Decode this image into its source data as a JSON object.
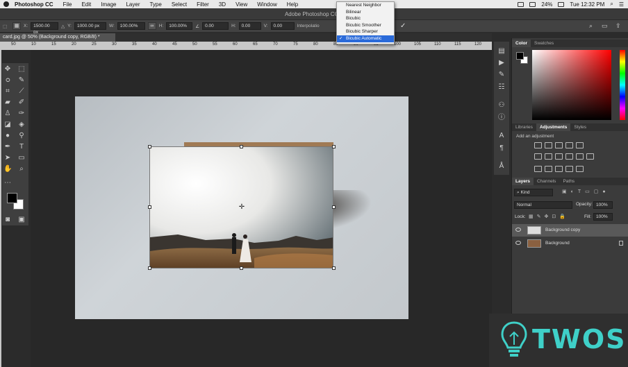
{
  "menubar": {
    "app_name": "Photoshop CC",
    "items": [
      "File",
      "Edit",
      "Image",
      "Layer",
      "Type",
      "Select",
      "Filter",
      "3D",
      "View",
      "Window",
      "Help"
    ],
    "battery": "24%",
    "clock": "Tue 12:32 PM"
  },
  "window": {
    "title": "Adobe Photoshop CC 2"
  },
  "options_bar": {
    "x_label": "X:",
    "x_value": "1500.00 px",
    "y_label": "Y:",
    "y_value": "1000.00 px",
    "w_label": "W:",
    "w_value": "100.00%",
    "h_label": "H:",
    "h_value": "100.00%",
    "angle_value": "0.00",
    "hskew_label": "H:",
    "hskew_value": "0.00",
    "vskew_label": "V:",
    "vskew_value": "0.00",
    "interp_label": "Interpolatio"
  },
  "interpolation_menu": {
    "options": [
      "Nearest Neighbor",
      "Bilinear",
      "Bicubic",
      "Bicubic Smoother",
      "Bicubic Sharper",
      "Bicubic Automatic"
    ],
    "selected": "Bicubic Automatic"
  },
  "document_tab": {
    "label": "card.jpg @ 50% (Background copy, RGB/8) *"
  },
  "ruler_ticks": [
    "50",
    "10",
    "15",
    "20",
    "25",
    "30",
    "35",
    "40",
    "45",
    "50",
    "55",
    "60",
    "65",
    "70",
    "75",
    "80",
    "85",
    "90",
    "95",
    "100",
    "105",
    "110",
    "115",
    "120"
  ],
  "color_panel": {
    "tabs": [
      "Color",
      "Swatches"
    ],
    "active": "Color"
  },
  "adjustments_panel": {
    "tabs": [
      "Libraries",
      "Adjustments",
      "Styles"
    ],
    "active": "Adjustments",
    "heading": "Add an adjustment"
  },
  "layers_panel": {
    "tabs": [
      "Layers",
      "Channels",
      "Paths"
    ],
    "active": "Layers",
    "filter_kind": "Kind",
    "blend_mode": "Normal",
    "opacity_label": "Opacity:",
    "opacity_value": "100%",
    "lock_label": "Lock:",
    "fill_label": "Fill:",
    "fill_value": "100%",
    "layers": [
      {
        "name": "Background copy",
        "selected": true
      },
      {
        "name": "Background",
        "selected": false,
        "locked": true
      }
    ]
  },
  "watermark": {
    "text": "TWOS"
  },
  "colors": {
    "selection_blue": "#2a6ad9",
    "watermark_teal": "#3fd0c8"
  }
}
